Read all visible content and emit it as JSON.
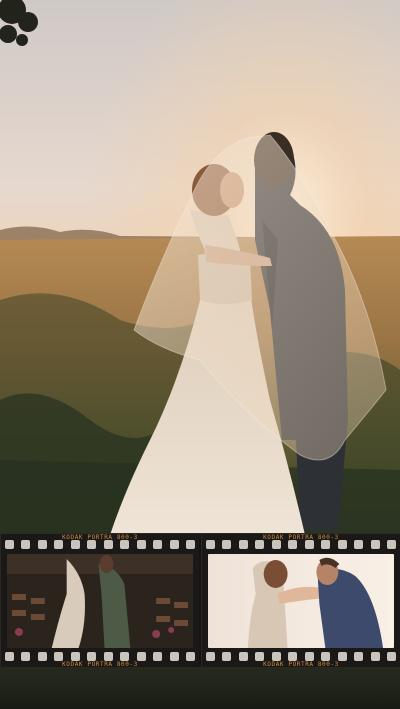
{
  "hero": {
    "image": "wedding-couple-veil-sunset-photo"
  },
  "filmstrip": {
    "frames": [
      {
        "label_top": "KODAK PORTRA 800-3",
        "label_bottom": "KODAK PORTRA 800-3",
        "image": "couple-wedding-aisle-photo"
      },
      {
        "label_top": "KODAK PORTRA 800-3",
        "label_bottom": "KODAK PORTRA 800-3",
        "image": "couple-embrace-closeup-photo"
      }
    ]
  },
  "colors": {
    "sky": "#e2d2c4",
    "sun_glow": "#f3c79a",
    "field_gold": "#a9823f",
    "dress": "#e8dccd",
    "suit": "#2d3136",
    "film_base": "#151412",
    "film_label": "#d08a44"
  }
}
